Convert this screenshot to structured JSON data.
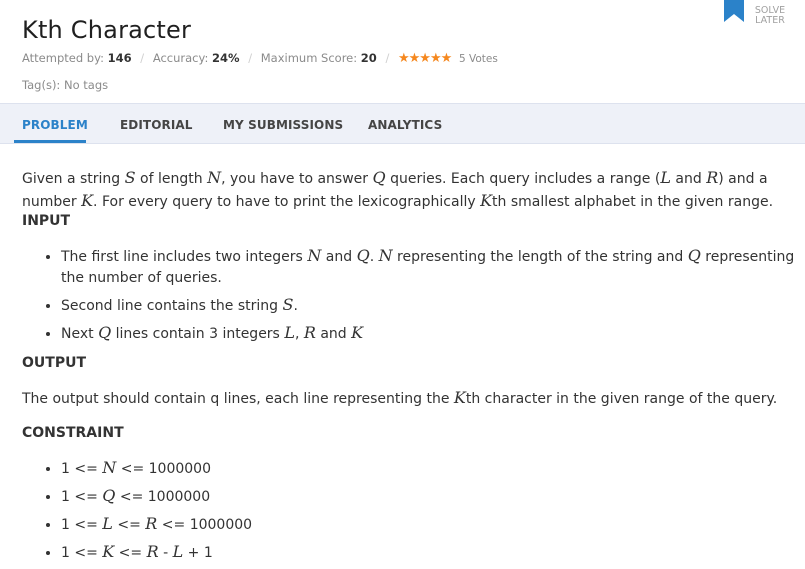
{
  "problem": {
    "title": "Kth Character",
    "attempted_label": "Attempted by:",
    "attempted_value": "146",
    "accuracy_label": "Accuracy:",
    "accuracy_value": "24%",
    "max_score_label": "Maximum Score:",
    "max_score_value": "20",
    "stars": "★★★★★",
    "votes": "5 Votes",
    "tags": "Tag(s): No tags",
    "solve_later": "SOLVE LATER"
  },
  "tabs": [
    {
      "label": "PROBLEM",
      "active": true
    },
    {
      "label": "EDITORIAL",
      "active": false
    },
    {
      "label": "MY SUBMISSIONS",
      "active": false
    },
    {
      "label": "ANALYTICS",
      "active": false
    }
  ],
  "colors": {
    "accent": "#2b82c9",
    "star": "#f5881f",
    "tab_background": "#eef1f8"
  },
  "icons": {
    "bookmark": "bookmark-icon",
    "star": "star-icon"
  },
  "statement": {
    "intro": {
      "t1": "Given a string ",
      "S": "S",
      "t2": " of length ",
      "N": "N",
      "t3": ", you have to answer ",
      "Q": "Q",
      "t4": " queries. Each query includes a range (",
      "L": "L",
      "t5": " and ",
      "R": "R",
      "t6": ") and a number ",
      "K": "K",
      "t7": ". For every query to have to print the lexicographically ",
      "K2": "K",
      "t8": "th smallest alphabet in the given range."
    },
    "input_heading": "INPUT",
    "input_items": {
      "i1": {
        "t1": "The first line includes two integers ",
        "N": "N",
        "t2": " and ",
        "Q": "Q",
        "t3": ". ",
        "N2": "N",
        "t4": " representing the length of the string and ",
        "Q2": "Q",
        "t5": " representing the number of queries."
      },
      "i2": {
        "t1": "Second line contains the string ",
        "S": "S",
        "t2": "."
      },
      "i3": {
        "t1": "Next ",
        "Q": "Q",
        "t2": " lines contain 3 integers ",
        "L": "L",
        "t3": ", ",
        "R": "R",
        "t4": " and ",
        "K": "K"
      }
    },
    "output_heading": "OUTPUT",
    "output_text": {
      "t1": "The output should contain q lines, each line representing the ",
      "K": "K",
      "t2": "th character in the given range of the query."
    },
    "constraint_heading": "CONSTRAINT",
    "constraints": {
      "c1": {
        "pre": "1 <= ",
        "var": "N",
        "post": " <= 1000000"
      },
      "c2": {
        "pre": "1 <= ",
        "var": "Q",
        "post": " <= 1000000"
      },
      "c3": {
        "pre": "1 <= ",
        "var": "L",
        "mid": " <= ",
        "var2": "R",
        "post": " <= 1000000"
      },
      "c4": {
        "pre": "1 <= ",
        "var": "K",
        "mid": " <= ",
        "var2": "R",
        "mid2": " - ",
        "var3": "L",
        "post": " + 1"
      }
    }
  }
}
